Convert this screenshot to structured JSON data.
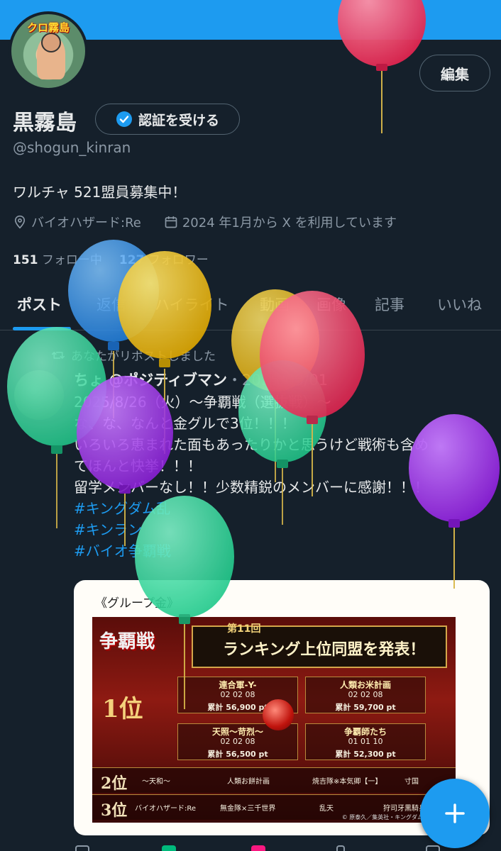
{
  "profile": {
    "avatar_label": "クロ霧島",
    "edit_label": "編集",
    "display_name": "黒霧島",
    "verify_label": "認証を受ける",
    "handle": "@shogun_kinran",
    "bio": "ワルチャ 521盟員募集中！",
    "location": "バイオハザード:Re",
    "joined": "2024 年1月から X を利用しています",
    "following_count": "151",
    "following_label": "フォロー中",
    "followers_count": "127",
    "followers_label": "フォロワー"
  },
  "tabs": [
    {
      "label": "ポスト",
      "active": true
    },
    {
      "label": "返信"
    },
    {
      "label": "ハイライト"
    },
    {
      "label": "動画"
    },
    {
      "label": "画像"
    },
    {
      "label": "記事"
    },
    {
      "label": "いいね"
    }
  ],
  "post": {
    "repost_label": "あなたがリポストしました",
    "author_name": "ちょ @ポジティブマン",
    "date": "・2025/09/01",
    "lines": [
      "2025/8/26（火）〜争覇戦（選抜戦）〜",
      "な、な、なんと金グルで3位！！！",
      "いろいろ恵まれた面もあったりかと思うけど戦術も含め",
      "てほんと快挙！！！",
      "留学メンバーなし！！少数精鋭のメンバーに感謝！！！"
    ],
    "hashtags": [
      "#キングダム乱",
      "#キンラン",
      "#バイオ争覇戦"
    ]
  },
  "card": {
    "caption": "《グループ金》",
    "logo": "争覇戦",
    "badge": "第11回",
    "title": "ランキング上位同盟を発表！",
    "first_label": "1位",
    "teams": [
      {
        "name": "連合軍-Y-",
        "score": "02 02 08",
        "points": "累計 56,900 pt"
      },
      {
        "name": "人類お米計画",
        "score": "02 02 08",
        "points": "累計 59,700 pt"
      },
      {
        "name": "天照〜苛烈〜",
        "score": "02 02 08",
        "points": "累計 56,500 pt"
      },
      {
        "name": "争覇師たち",
        "score": "01 01 10",
        "points": "累計 52,300 pt"
      }
    ],
    "rows": [
      {
        "rank": "2位",
        "items": [
          "〜天和〜",
          "人類お餅計画",
          "焼吉隊※本気卿【一】",
          "寸国"
        ]
      },
      {
        "rank": "3位",
        "items": [
          "バイオハザード:Re",
          "無金隊×三千世界",
          "乱天",
          "狩司牙黒騎兵"
        ]
      }
    ],
    "copyright": "© 原泰久／集英社・キングダム製作委員会"
  },
  "colors": {
    "accent": "#1d9bf0",
    "background": "#15202b",
    "muted": "#8b98a5"
  },
  "icons": {
    "location": "location-pin-icon",
    "calendar": "calendar-icon",
    "verified": "verified-badge-icon",
    "repost": "repost-icon",
    "compose": "plus-icon"
  }
}
